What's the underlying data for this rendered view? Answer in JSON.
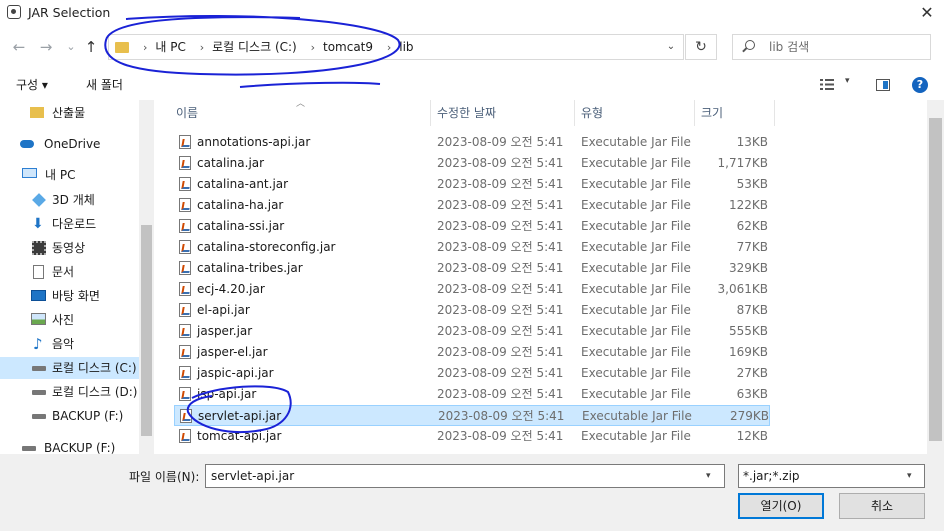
{
  "window": {
    "title": "JAR Selection",
    "close": "✕"
  },
  "nav": {
    "back": "←",
    "forward": "→",
    "recent": "⌄",
    "up": "↑"
  },
  "address": {
    "crumbs": [
      "내 PC",
      "로컬 디스크 (C:)",
      "tomcat9",
      "lib"
    ],
    "dropdown": "⌄",
    "refresh": "↻"
  },
  "search": {
    "placeholder": "lib 검색"
  },
  "toolbar": {
    "organize": "구성 ▾",
    "new_folder": "새 폴더",
    "view_dd": "▾",
    "help": "?"
  },
  "sidebar": {
    "items": [
      {
        "label": "산출물",
        "icon": "folder-icon"
      },
      {
        "label": "OneDrive",
        "icon": "cloud-icon"
      },
      {
        "label": "내 PC",
        "icon": "pc-icon"
      },
      {
        "label": "3D 개체",
        "icon": "cube-icon"
      },
      {
        "label": "다운로드",
        "icon": "download-icon"
      },
      {
        "label": "동영상",
        "icon": "video-icon"
      },
      {
        "label": "문서",
        "icon": "document-icon"
      },
      {
        "label": "바탕 화면",
        "icon": "desktop-icon"
      },
      {
        "label": "사진",
        "icon": "picture-icon"
      },
      {
        "label": "음악",
        "icon": "music-icon"
      },
      {
        "label": "로컬 디스크 (C:)",
        "icon": "drive-icon"
      },
      {
        "label": "로컬 디스크 (D:)",
        "icon": "drive-icon"
      },
      {
        "label": "BACKUP (F:)",
        "icon": "drive-icon"
      },
      {
        "label": "BACKUP (F:)",
        "icon": "drive-icon"
      }
    ]
  },
  "columns": {
    "name": "이름",
    "date": "수정한 날짜",
    "type": "유형",
    "size": "크기"
  },
  "files": [
    {
      "name": "annotations-api.jar",
      "date": "2023-08-09 오전 5:41",
      "type": "Executable Jar File",
      "size": "13KB"
    },
    {
      "name": "catalina.jar",
      "date": "2023-08-09 오전 5:41",
      "type": "Executable Jar File",
      "size": "1,717KB"
    },
    {
      "name": "catalina-ant.jar",
      "date": "2023-08-09 오전 5:41",
      "type": "Executable Jar File",
      "size": "53KB"
    },
    {
      "name": "catalina-ha.jar",
      "date": "2023-08-09 오전 5:41",
      "type": "Executable Jar File",
      "size": "122KB"
    },
    {
      "name": "catalina-ssi.jar",
      "date": "2023-08-09 오전 5:41",
      "type": "Executable Jar File",
      "size": "62KB"
    },
    {
      "name": "catalina-storeconfig.jar",
      "date": "2023-08-09 오전 5:41",
      "type": "Executable Jar File",
      "size": "77KB"
    },
    {
      "name": "catalina-tribes.jar",
      "date": "2023-08-09 오전 5:41",
      "type": "Executable Jar File",
      "size": "329KB"
    },
    {
      "name": "ecj-4.20.jar",
      "date": "2023-08-09 오전 5:41",
      "type": "Executable Jar File",
      "size": "3,061KB"
    },
    {
      "name": "el-api.jar",
      "date": "2023-08-09 오전 5:41",
      "type": "Executable Jar File",
      "size": "87KB"
    },
    {
      "name": "jasper.jar",
      "date": "2023-08-09 오전 5:41",
      "type": "Executable Jar File",
      "size": "555KB"
    },
    {
      "name": "jasper-el.jar",
      "date": "2023-08-09 오전 5:41",
      "type": "Executable Jar File",
      "size": "169KB"
    },
    {
      "name": "jaspic-api.jar",
      "date": "2023-08-09 오전 5:41",
      "type": "Executable Jar File",
      "size": "27KB"
    },
    {
      "name": "jsp-api.jar",
      "date": "2023-08-09 오전 5:41",
      "type": "Executable Jar File",
      "size": "63KB"
    },
    {
      "name": "servlet-api.jar",
      "date": "2023-08-09 오전 5:41",
      "type": "Executable Jar File",
      "size": "279KB"
    },
    {
      "name": "tomcat-api.jar",
      "date": "2023-08-09 오전 5:41",
      "type": "Executable Jar File",
      "size": "12KB"
    }
  ],
  "selected_file_index": 13,
  "selected_sidebar_index": 10,
  "bottom": {
    "filename_label": "파일 이름(N):",
    "filename_value": "servlet-api.jar",
    "filter_value": "*.jar;*.zip",
    "open": "열기(O)",
    "cancel": "취소"
  },
  "colors": {
    "accent": "#0078d7",
    "selection": "#cce8ff",
    "annotation": "#1a22d6"
  }
}
